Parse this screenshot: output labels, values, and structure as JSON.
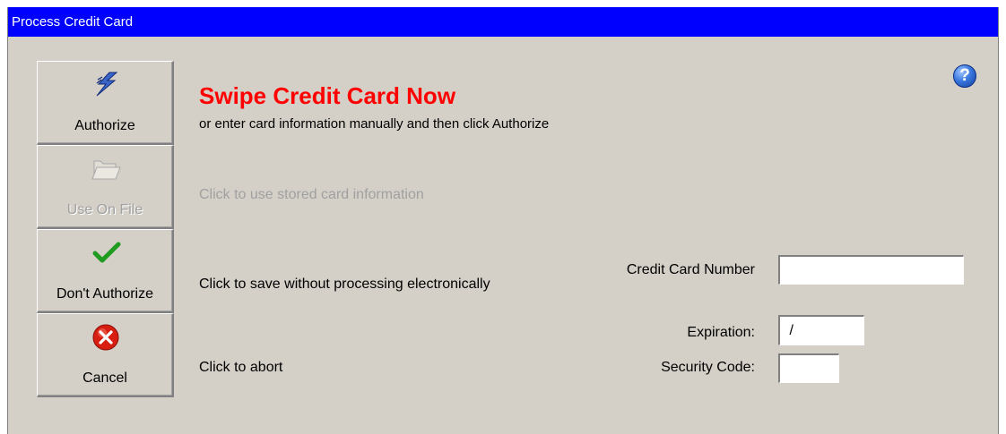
{
  "window": {
    "title": "Process Credit Card"
  },
  "help": {
    "glyph": "?",
    "icon": "help-icon"
  },
  "buttons": [
    {
      "label": "Authorize",
      "icon": "lightning-bolt-icon",
      "enabled": true
    },
    {
      "label": "Use On File",
      "icon": "folder-icon",
      "enabled": false
    },
    {
      "label": "Don't Authorize",
      "icon": "checkmark-icon",
      "enabled": true
    },
    {
      "label": "Cancel",
      "icon": "red-x-icon",
      "enabled": true
    }
  ],
  "main": {
    "heading": "Swipe Credit Card Now",
    "subheading": "or enter card information manually and then click Authorize",
    "use_on_file_desc": "Click to use stored card information",
    "dont_authorize_desc": "Click to save without processing electronically",
    "cancel_desc": "Click to abort"
  },
  "form": {
    "card_number_label": "Credit Card Number",
    "card_number_value": "",
    "expiration_label": "Expiration:",
    "expiration_value": " /",
    "security_code_label": "Security Code:",
    "security_code_value": ""
  },
  "colors": {
    "titlebar": "#0000fe",
    "heading": "#ff0000",
    "window_bg": "#d4d0c8"
  }
}
